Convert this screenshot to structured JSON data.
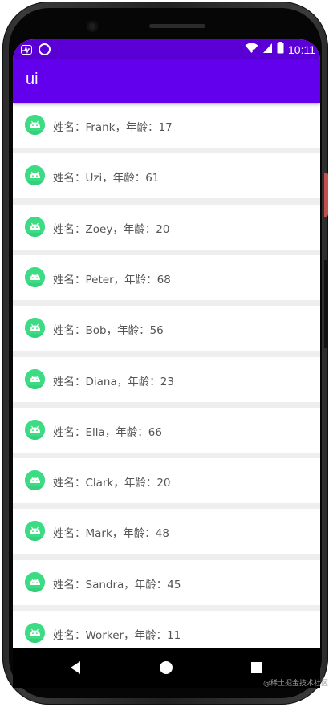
{
  "status_bar": {
    "time": "10:11",
    "left_icons": [
      "activity-icon",
      "circle-icon"
    ],
    "right_icons": [
      "wifi-icon",
      "signal-icon",
      "battery-icon"
    ],
    "color": "#5a00d6"
  },
  "app_bar": {
    "title": "ui",
    "color": "#6200ee"
  },
  "list": {
    "items": [
      {
        "label": "姓名：Frank，年龄：17"
      },
      {
        "label": "姓名：Uzi，年龄：61"
      },
      {
        "label": "姓名：Zoey，年龄：20"
      },
      {
        "label": "姓名：Peter，年龄：68"
      },
      {
        "label": "姓名：Bob，年龄：56"
      },
      {
        "label": "姓名：Diana，年龄：23"
      },
      {
        "label": "姓名：Ella，年龄：66"
      },
      {
        "label": "姓名：Clark，年龄：20"
      },
      {
        "label": "姓名：Mark，年龄：48"
      },
      {
        "label": "姓名：Sandra，年龄：45"
      },
      {
        "label": "姓名：Worker，年龄：11"
      }
    ],
    "avatar_icon": "android-icon",
    "avatar_color": "#3ddc84"
  },
  "nav_bar": {
    "icons": [
      "back-icon",
      "home-icon",
      "recents-icon"
    ]
  },
  "watermark": "@稀土掘金技术社区"
}
